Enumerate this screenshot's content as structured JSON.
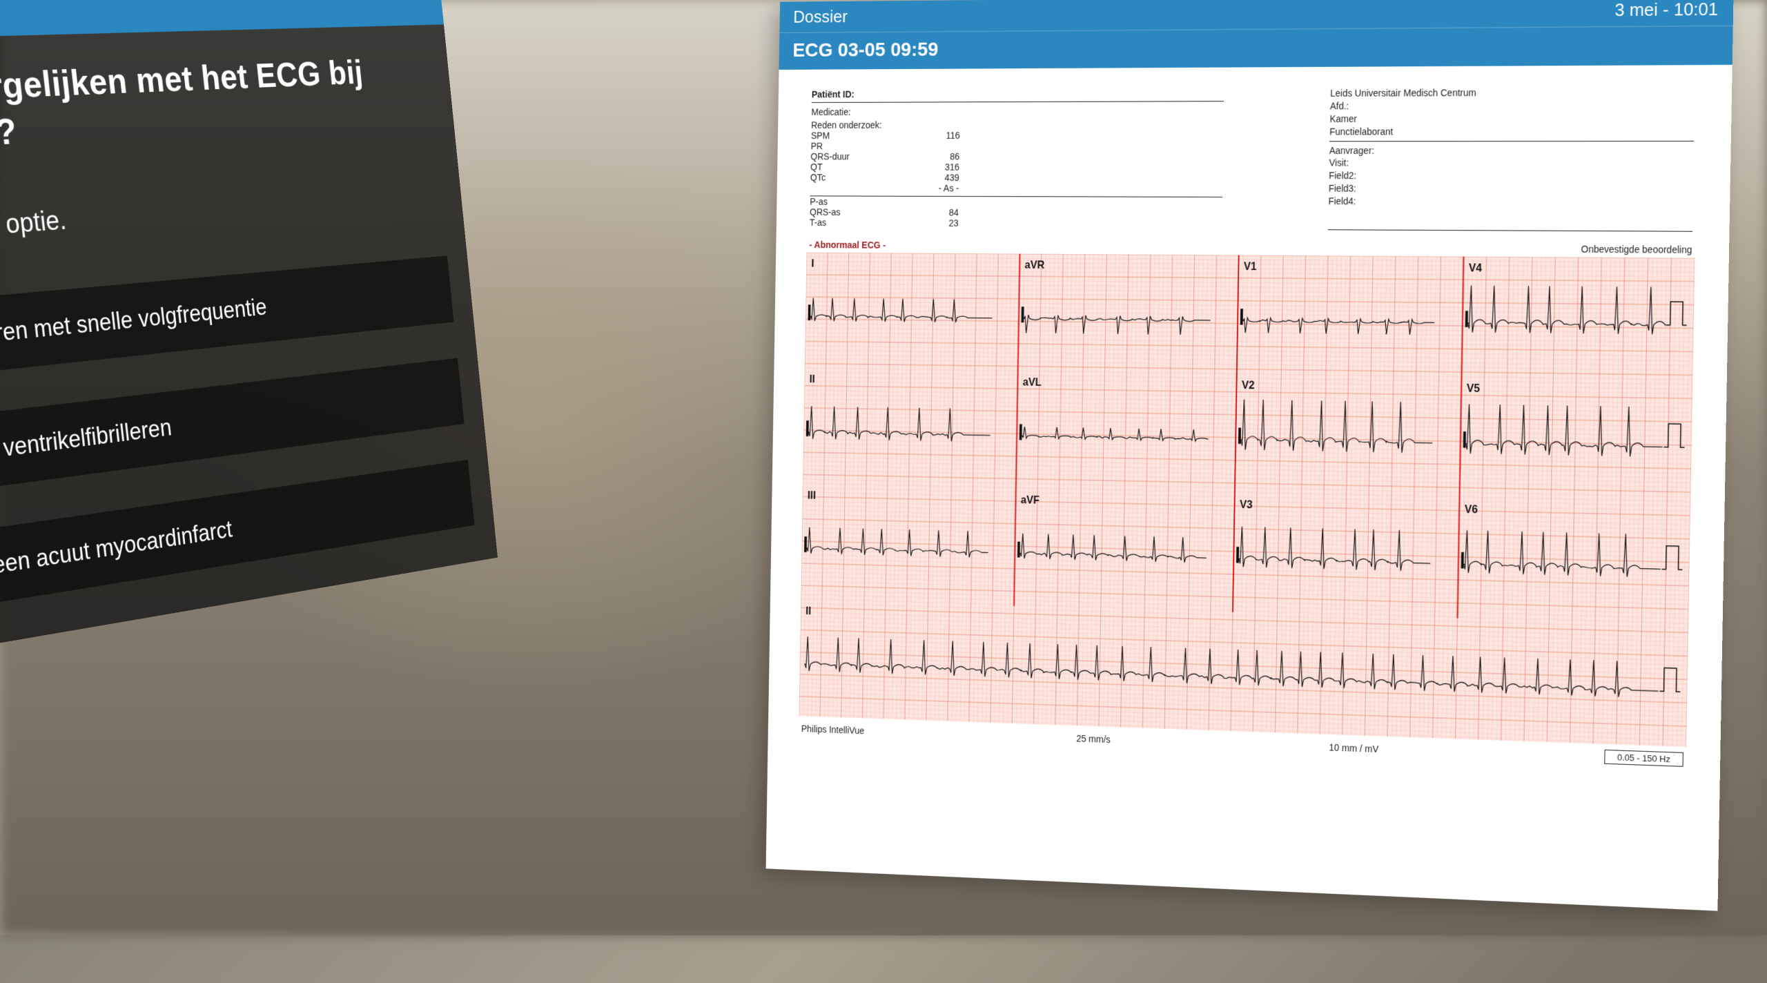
{
  "question": {
    "title_line1": "en vergelijken met het ECG bij",
    "title_line2": "name?",
    "instruction": "e beste optie.",
    "options": [
      "brilleren met snelle volgfrequentie",
      "van ventrikelfibrilleren",
      "n een acuut myocardinfarct"
    ]
  },
  "dossier": {
    "header_label": "Dossier",
    "timestamp": "3 mei - 10:01",
    "subtitle": "ECG 03-05 09:59"
  },
  "ecg_meta": {
    "patient_id_label": "Patiënt ID:",
    "medication_label": "Medicatie:",
    "reason_label": "Reden onderzoek:",
    "params": [
      {
        "label": "SPM",
        "value": "116"
      },
      {
        "label": "PR",
        "value": ""
      },
      {
        "label": "QRS-duur",
        "value": "86"
      },
      {
        "label": "QT",
        "value": "316"
      },
      {
        "label": "QTc",
        "value": "439"
      }
    ],
    "axis_header": "- As -",
    "axes": [
      {
        "label": "P-as",
        "value": ""
      },
      {
        "label": "QRS-as",
        "value": "84"
      },
      {
        "label": "T-as",
        "value": "23"
      }
    ],
    "institution": "Leids Universitair Medisch Centrum",
    "right_fields": [
      "Afd.:",
      "Kamer",
      "Functielaborant"
    ],
    "right_bottom_fields": [
      "Aanvrager:",
      "Visit:",
      "Field2:",
      "Field3:",
      "Field4:"
    ]
  },
  "ecg_status": {
    "left": "- Abnormaal ECG -",
    "right": "Onbevestigde beoordeling"
  },
  "ecg_leads": {
    "row1": [
      "I",
      "aVR",
      "V1",
      "V4"
    ],
    "row2": [
      "II",
      "aVL",
      "V2",
      "V5"
    ],
    "row3": [
      "III",
      "aVF",
      "V3",
      "V6"
    ],
    "row4": [
      "II"
    ]
  },
  "ecg_footer": {
    "device": "Philips IntelliVue",
    "speed": "25 mm/s",
    "gain": "10 mm / mV",
    "filter": "0.05 - 150 Hz"
  }
}
